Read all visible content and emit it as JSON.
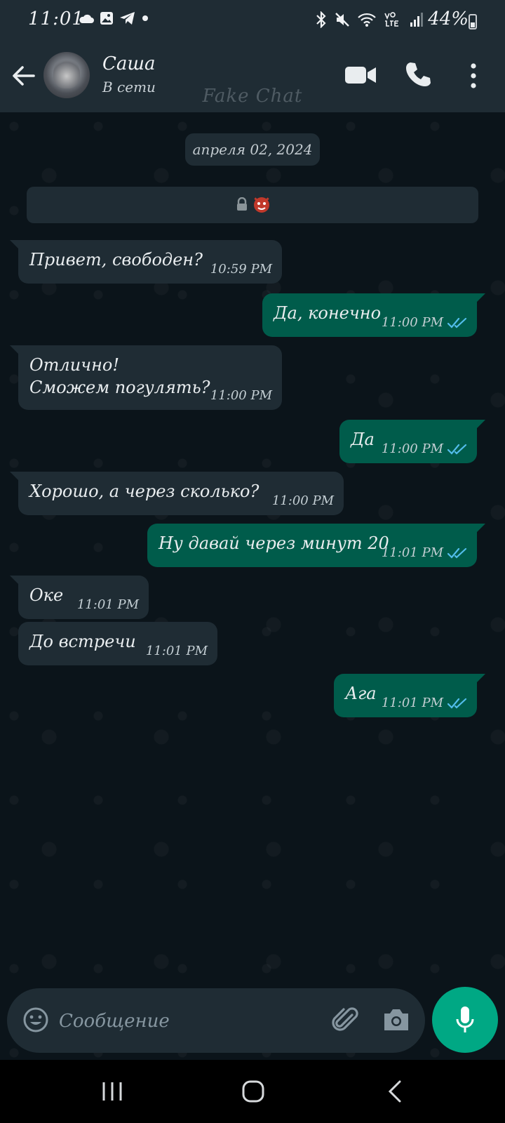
{
  "status_bar": {
    "time": "11:01",
    "battery": "44%",
    "battery_level": 0.44
  },
  "header": {
    "contact_name": "Саша",
    "contact_status": "В сети",
    "watermark": "Fake Chat"
  },
  "chat": {
    "date_chip": "апреля 02, 2024",
    "messages": [
      {
        "direction": "in",
        "text": "Привет, свободен?",
        "time": "10:59 PM"
      },
      {
        "direction": "out",
        "text": "Да, конечно",
        "time": "11:00 PM"
      },
      {
        "direction": "in",
        "text": "Отлично!\nСможем погулять?",
        "time": "11:00 PM"
      },
      {
        "direction": "out",
        "text": "Да",
        "time": "11:00 PM"
      },
      {
        "direction": "in",
        "text": "Хорошо,  а через сколько?",
        "time": "11:00 PM"
      },
      {
        "direction": "out",
        "text": "Ну давай через минут 20",
        "time": "11:01 PM"
      },
      {
        "direction": "in",
        "text": "Оке",
        "time": "11:01 PM"
      },
      {
        "direction": "in",
        "text": "До встречи",
        "time": "11:01 PM"
      },
      {
        "direction": "out",
        "text": "Ага",
        "time": "11:01 PM"
      }
    ]
  },
  "input": {
    "placeholder": "Сообщение"
  },
  "colors": {
    "incoming_bubble": "#1f2c34",
    "outgoing_bubble": "#005c4b",
    "read_ticks": "#53bdeb",
    "accent": "#00a884"
  }
}
